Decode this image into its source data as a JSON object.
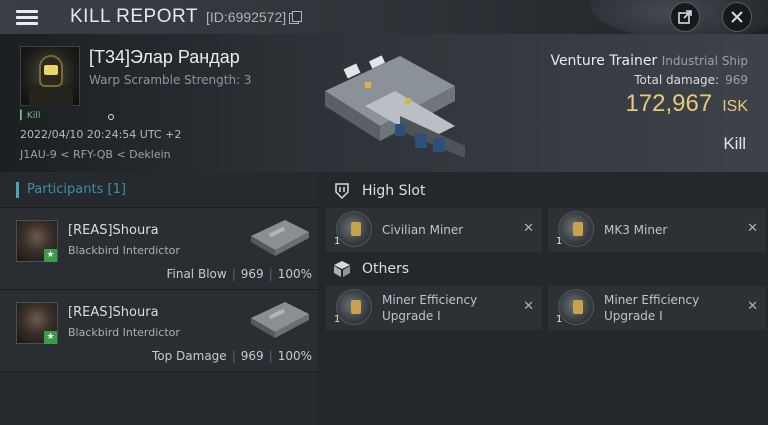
{
  "topbar": {
    "title": "KILL REPORT",
    "report_id": "[ID:6992572]"
  },
  "victim": {
    "name": "[T34]Элар Рандар",
    "scramble": "Warp Scramble Strength: 3",
    "kill_tag": "Kill",
    "datetime": "2022/04/10 20:24:54 UTC +2",
    "location": "J1AU-9 < RFY-QB < Deklein"
  },
  "ship": {
    "name": "Venture Trainer",
    "class": "Industrial Ship",
    "total_damage_label": "Total damage:",
    "total_damage": "969",
    "isk_value": "172,967",
    "isk_unit": "ISK",
    "result": "Kill"
  },
  "participants": {
    "header": "Participants [1]",
    "list": [
      {
        "name": "[REAS]Shoura",
        "ship": "Blackbird Interdictor",
        "role": "Final Blow",
        "damage": "969",
        "percent": "100%"
      },
      {
        "name": "[REAS]Shoura",
        "ship": "Blackbird Interdictor",
        "role": "Top Damage",
        "damage": "969",
        "percent": "100%"
      }
    ]
  },
  "fitting": {
    "high_slot": {
      "label": "High Slot",
      "items": [
        {
          "qty": "1",
          "name": "Civilian Miner",
          "name2": ""
        },
        {
          "qty": "1",
          "name": "MK3 Miner",
          "name2": ""
        }
      ]
    },
    "others": {
      "label": "Others",
      "items": [
        {
          "qty": "1",
          "name": "Miner Efficiency",
          "name2": "Upgrade I"
        },
        {
          "qty": "1",
          "name": "Miner Efficiency",
          "name2": "Upgrade I"
        }
      ]
    }
  },
  "colors": {
    "isk": "#e9c879",
    "accent": "#4aa6b7",
    "badge": "#3a9c4a"
  }
}
